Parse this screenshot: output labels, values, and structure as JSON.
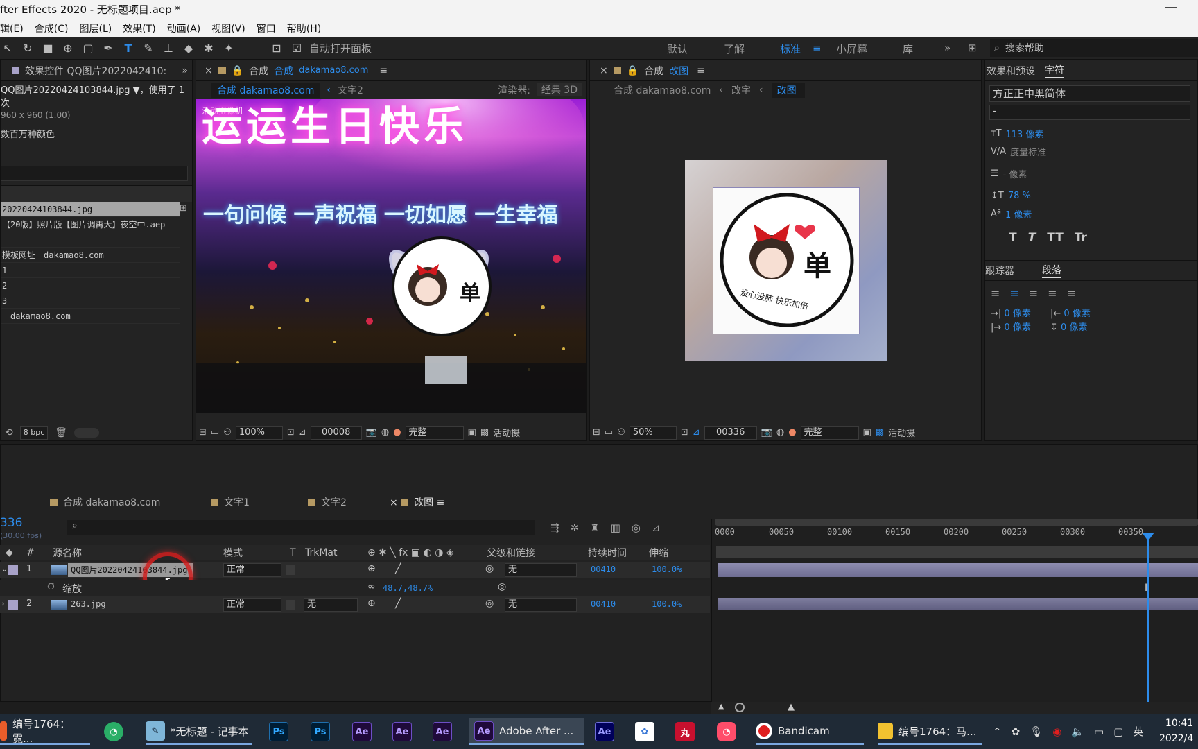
{
  "window": {
    "title": "fter Effects 2020 - 无标题项目.aep *",
    "minimize": "—"
  },
  "menu": [
    "辑(E)",
    "合成(C)",
    "图层(L)",
    "效果(T)",
    "动画(A)",
    "视图(V)",
    "窗口",
    "帮助(H)"
  ],
  "toolbar": {
    "auto_open_label": "自动打开面板",
    "workspaces": [
      "默认",
      "了解",
      "标准",
      "小屏幕",
      "库"
    ],
    "active_workspace": "标准",
    "search_placeholder": "搜索帮助",
    "more": "»"
  },
  "effects_panel": {
    "tab": "效果控件 QQ图片2022042410:",
    "file": "QQ图片20220424103844.jpg ▼，使用了 1 次",
    "dims": "960 x 960 (1.00)",
    "color": "数百万种颜色"
  },
  "project": {
    "items": [
      "20220424103844.jpg",
      "【20版】照片版【图片调再大】夜空中.aep",
      "",
      "模板网址　dakamao8.com",
      "1",
      "2",
      "3",
      "　dakamao8.com"
    ],
    "bpc": "8 bpc"
  },
  "comp_left": {
    "tab_prefix": "合成",
    "tab_blue": "合成",
    "tab_name": "dakamao8.com",
    "crumb_active": "合成 dakamao8.com",
    "crumb_next": "文字2",
    "renderer_label": "渲染器:",
    "renderer_value": "经典 3D",
    "camera_label": "活动摄像机",
    "canvas_text_top": "运运生日快乐",
    "canvas_text_line": "一句问候 一声祝福 一切如愿 一生幸福",
    "zoom": "100%",
    "frame": "00008",
    "quality": "完整",
    "view": "活动摄"
  },
  "comp_right": {
    "tab_prefix": "合成",
    "tab_name": "改图",
    "crumb1": "合成 dakamao8.com",
    "crumb2": "改字",
    "crumb3": "改图",
    "badge_char": "单",
    "badge_text": "没心没肺 快乐加倍",
    "zoom": "50%",
    "frame": "00336",
    "quality": "完整",
    "view": "活动摄"
  },
  "char_panel": {
    "tab1": "效果和预设",
    "tab2": "字符",
    "font": "方正正中黑简体",
    "style": "-",
    "size": "113 像素",
    "kerning": "度量标准",
    "leading": "- 像素",
    "vscale": "78 %",
    "baseline": "1 像素",
    "styles": [
      "T",
      "T",
      "TT",
      "Tr"
    ],
    "tab3": "跟踪器",
    "tab4": "段落",
    "indent1": "0 像素",
    "indent2": "0 像素",
    "indent3": "0 像素",
    "indent4": "0 像素"
  },
  "timeline": {
    "tabs": [
      "合成 dakamao8.com",
      "文字1",
      "文字2",
      "改图"
    ],
    "active_tab": "改图",
    "timecode": "336",
    "fps": "(30.00 fps)",
    "columns": [
      "#",
      "源名称",
      "模式",
      "T",
      "TrkMat",
      "父级和链接",
      "持续时间",
      "伸缩"
    ],
    "ruler": [
      "0000",
      "00050",
      "00100",
      "00150",
      "00200",
      "00250",
      "00300",
      "00350"
    ],
    "layers": [
      {
        "num": "1",
        "name": "QQ图片20220424103844.jpg",
        "mode": "正常",
        "trkmat": "",
        "parent": "无",
        "duration": "00410",
        "stretch": "100.0%"
      },
      {
        "num": "2",
        "name": "263.jpg",
        "mode": "正常",
        "trkmat": "无",
        "parent": "无",
        "duration": "00410",
        "stretch": "100.0%"
      }
    ],
    "scale_label": "缩放",
    "scale_value": "48.7,48.7%"
  },
  "taskbar": {
    "items": [
      "编号1764：霓...",
      "*无标题 - 记事本",
      "Adobe After ...",
      "Bandicam",
      "编号1764：马..."
    ],
    "ime": "英",
    "time": "10:41",
    "date": "2022/4"
  }
}
